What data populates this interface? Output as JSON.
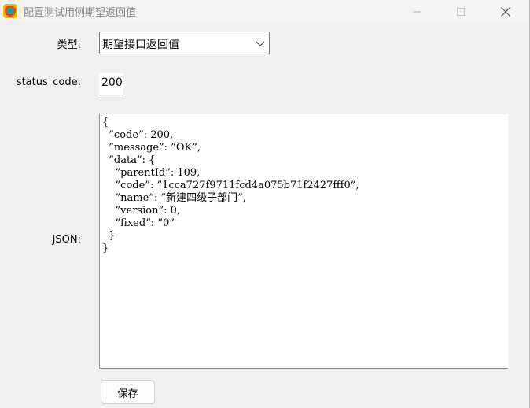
{
  "window": {
    "title": "配置测试用例期望返回值",
    "controls": [
      "minimize-icon",
      "maximize-icon",
      "close-icon"
    ]
  },
  "form": {
    "type_label": "类型:",
    "type_value": "期望接口返回值",
    "status_label": "status_code:",
    "status_value": "200",
    "json_label": "JSON:",
    "json_value": "{\n  ”code”: 200,\n  ”message”: ”OK”,\n  ”data”: {\n    ”parentId”: 109,\n    ”code”: ”1cca727f9711fcd4a075b71f2427fff0”,\n    ”name”: ”新建四级子部门”,\n    ”version”: 0,\n    ”fixed”: ”0”\n  }\n}"
  },
  "actions": {
    "save_label": "保存"
  },
  "colors": {
    "window_bg": "#f0f0f0",
    "field_bg": "#ffffff",
    "title_text": "#8a8a8a"
  }
}
